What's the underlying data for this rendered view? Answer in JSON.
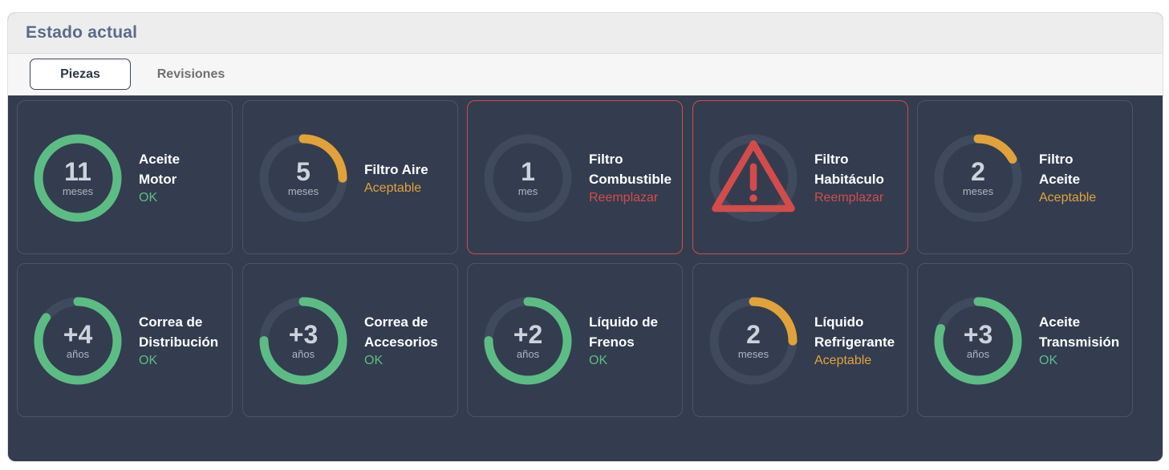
{
  "panel": {
    "title": "Estado actual"
  },
  "tabs": [
    {
      "label": "Piezas",
      "active": true
    },
    {
      "label": "Revisiones",
      "active": false
    }
  ],
  "colors": {
    "ok": "#5cbd84",
    "acceptable": "#e2a23a",
    "replace": "#d44b4b",
    "track": "#3f4a5e"
  },
  "parts": [
    {
      "name": "Aceite\nMotor",
      "status": "OK",
      "level": "ok",
      "value": "11",
      "unit": "meses",
      "fill": 1.0
    },
    {
      "name": "Filtro Aire",
      "status": "Aceptable",
      "level": "acceptable",
      "value": "5",
      "unit": "meses",
      "fill": 0.25
    },
    {
      "name": "Filtro\nCombustible",
      "status": "Reemplazar",
      "level": "replace",
      "value": "1",
      "unit": "mes",
      "fill": 0.0
    },
    {
      "name": "Filtro\nHabitáculo",
      "status": "Reemplazar",
      "level": "replace",
      "value": "",
      "unit": "",
      "fill": 0.0,
      "icon": "warning-icon"
    },
    {
      "name": "Filtro\nAceite",
      "status": "Aceptable",
      "level": "acceptable",
      "value": "2",
      "unit": "meses",
      "fill": 0.17
    },
    {
      "name": "Correa de\nDistribución",
      "status": "OK",
      "level": "ok",
      "value": "+4",
      "unit": "años",
      "fill": 0.85
    },
    {
      "name": "Correa de\nAccesorios",
      "status": "OK",
      "level": "ok",
      "value": "+3",
      "unit": "años",
      "fill": 0.75
    },
    {
      "name": "Líquido de\nFrenos",
      "status": "OK",
      "level": "ok",
      "value": "+2",
      "unit": "años",
      "fill": 0.75
    },
    {
      "name": "Líquido\nRefrigerante",
      "status": "Aceptable",
      "level": "acceptable",
      "value": "2",
      "unit": "meses",
      "fill": 0.25
    },
    {
      "name": "Aceite\nTransmisión",
      "status": "OK",
      "level": "ok",
      "value": "+3",
      "unit": "años",
      "fill": 0.8
    }
  ]
}
